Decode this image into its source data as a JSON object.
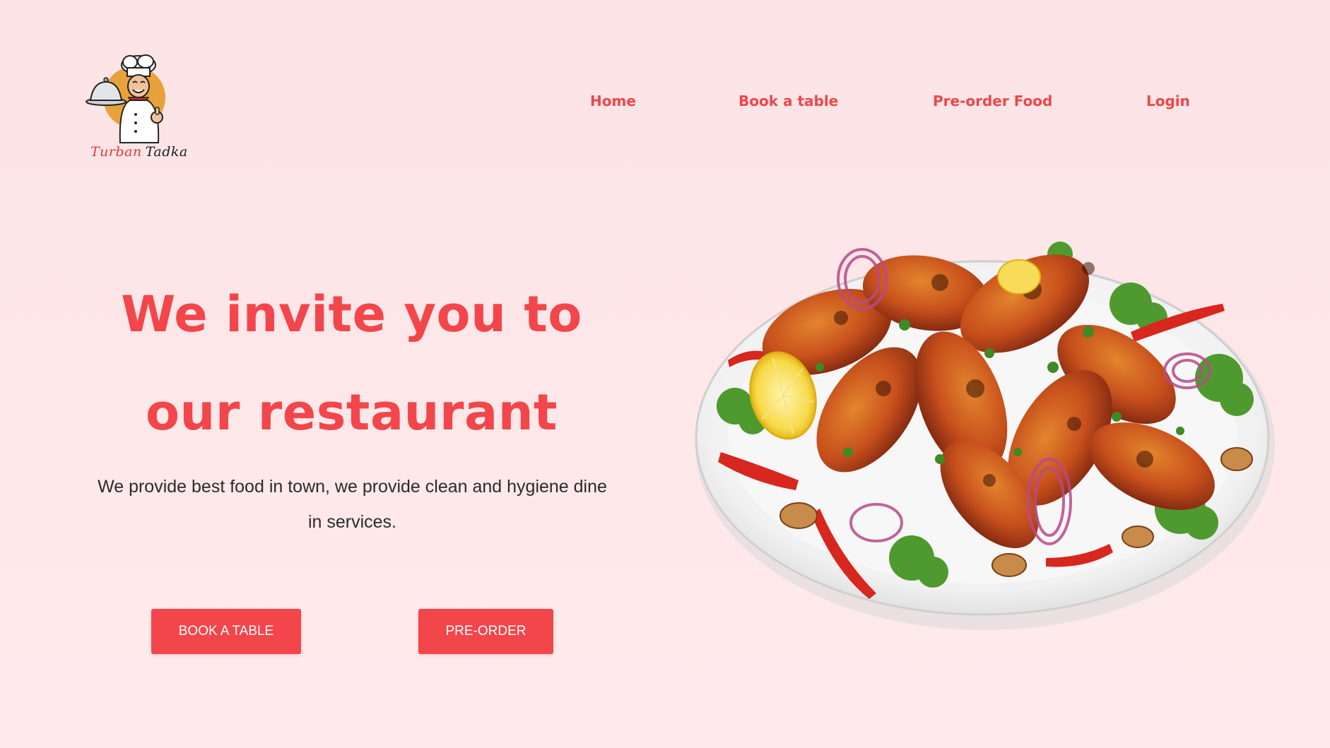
{
  "brand": {
    "name_part1": "Turban",
    "name_part2": "Tadka"
  },
  "nav": {
    "items": [
      {
        "label": "Home"
      },
      {
        "label": "Book a table"
      },
      {
        "label": "Pre-order Food"
      },
      {
        "label": "Login"
      }
    ]
  },
  "hero": {
    "title_line1": "We invite you to",
    "title_line2": "our restaurant",
    "description_line1": "We provide best food in town, we provide clean and hygiene dine",
    "description_line2": "in services.",
    "book_button": "BOOK A TABLE",
    "preorder_button": "PRE-ORDER"
  },
  "colors": {
    "accent": "#f2464b",
    "background": "#fde4e6",
    "text": "#2b2b2b"
  },
  "icons": {
    "logo": "chef-logo-icon",
    "hero_image": "tandoori-chicken-plate"
  }
}
